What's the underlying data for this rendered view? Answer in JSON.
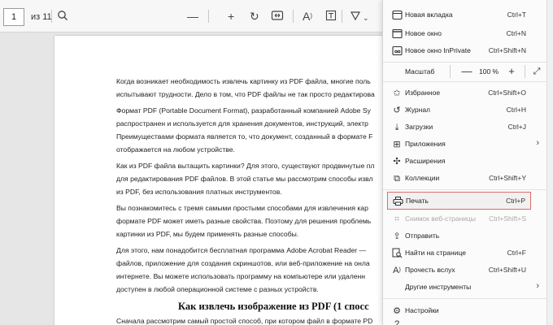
{
  "toolbar": {
    "page_number": "1",
    "page_total": "из 11"
  },
  "document": {
    "lines": [
      "Когда возникает необходимость извлечь картинку из PDF файла, многие поль",
      "испытывают трудности. Дело в том, что PDF файлы не так просто редактирова",
      "Формат PDF (Portable Document Format), разработанный компанией Adobe Sy",
      "распространен и используется для хранения документов, инструкций, электр",
      "Преимуществами формата является то, что документ, созданный в формате F",
      "отображается на любом устройстве.",
      "Как из PDF файла вытащить картинки? Для этого, существуют продвинутые пл",
      "для редактирования PDF файлов. В этой статье мы рассмотрим способы извл",
      "из PDF, без использования платных инструментов.",
      "Вы познакомитесь с тремя самыми простыми способами для извлечения кар",
      "формате PDF может иметь разные свойства. Поэтому для решения проблемь",
      "картинки из PDF, мы будем применять разные способы.",
      "Для этого, нам понадобится бесплатная программа Adobe Acrobat Reader —",
      "файлов, приложение для создания скриншотов, или веб-приложение на онла",
      "интернете. Вы можете использовать программу на компьютере или удаленн",
      "доступен в любой операционной системе с разных устройств.",
      "Сначала рассмотрим самый простой способ, при котором файл в формате PD"
    ],
    "heading": "Как извлечь изображение из PDF (1 спосс"
  },
  "menu": {
    "items": [
      {
        "label": "Новая вкладка",
        "shortcut": "Ctrl+T"
      },
      {
        "label": "Новое окно",
        "shortcut": "Ctrl+N"
      },
      {
        "label": "Новое окно InPrivate",
        "shortcut": "Ctrl+Shift+N"
      },
      {
        "label": "Избранное",
        "shortcut": "Ctrl+Shift+O"
      },
      {
        "label": "Журнал",
        "shortcut": "Ctrl+H"
      },
      {
        "label": "Загрузки",
        "shortcut": "Ctrl+J"
      },
      {
        "label": "Приложения",
        "shortcut": ""
      },
      {
        "label": "Расширения",
        "shortcut": ""
      },
      {
        "label": "Коллекции",
        "shortcut": "Ctrl+Shift+Y"
      },
      {
        "label": "Печать",
        "shortcut": "Ctrl+P"
      },
      {
        "label": "Снимок веб-страницы",
        "shortcut": "Ctrl+Shift+S"
      },
      {
        "label": "Отправить",
        "shortcut": ""
      },
      {
        "label": "Найти на странице",
        "shortcut": "Ctrl+F"
      },
      {
        "label": "Прочесть вслух",
        "shortcut": "Ctrl+Shift+U"
      },
      {
        "label": "Другие инструменты",
        "shortcut": ""
      },
      {
        "label": "Настройки",
        "shortcut": ""
      }
    ],
    "zoom": {
      "label": "Масштаб",
      "minus": "—",
      "value": "100 %",
      "plus": "+"
    }
  },
  "colors": {
    "highlight_border": "#e06a6a",
    "menu_bg": "#fbfbfb"
  }
}
